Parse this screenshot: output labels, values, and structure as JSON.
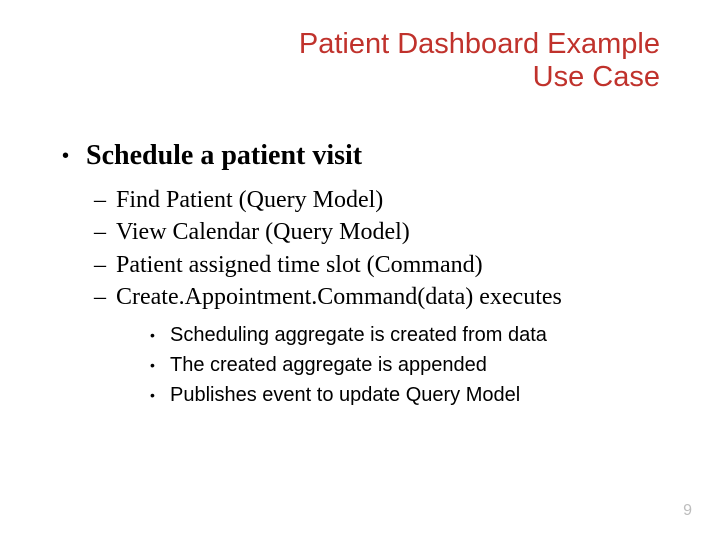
{
  "title": {
    "line1": "Patient Dashboard Example",
    "line2": "Use Case"
  },
  "heading": "Schedule a patient visit",
  "sub": [
    "Find Patient (Query Model)",
    "View Calendar (Query Model)",
    "Patient assigned time slot (Command)",
    "Create.Appointment.Command(data) executes"
  ],
  "subsub": [
    "Scheduling aggregate is created from data",
    "The created aggregate is appended",
    "Publishes event to update Query Model"
  ],
  "page_number": "9"
}
